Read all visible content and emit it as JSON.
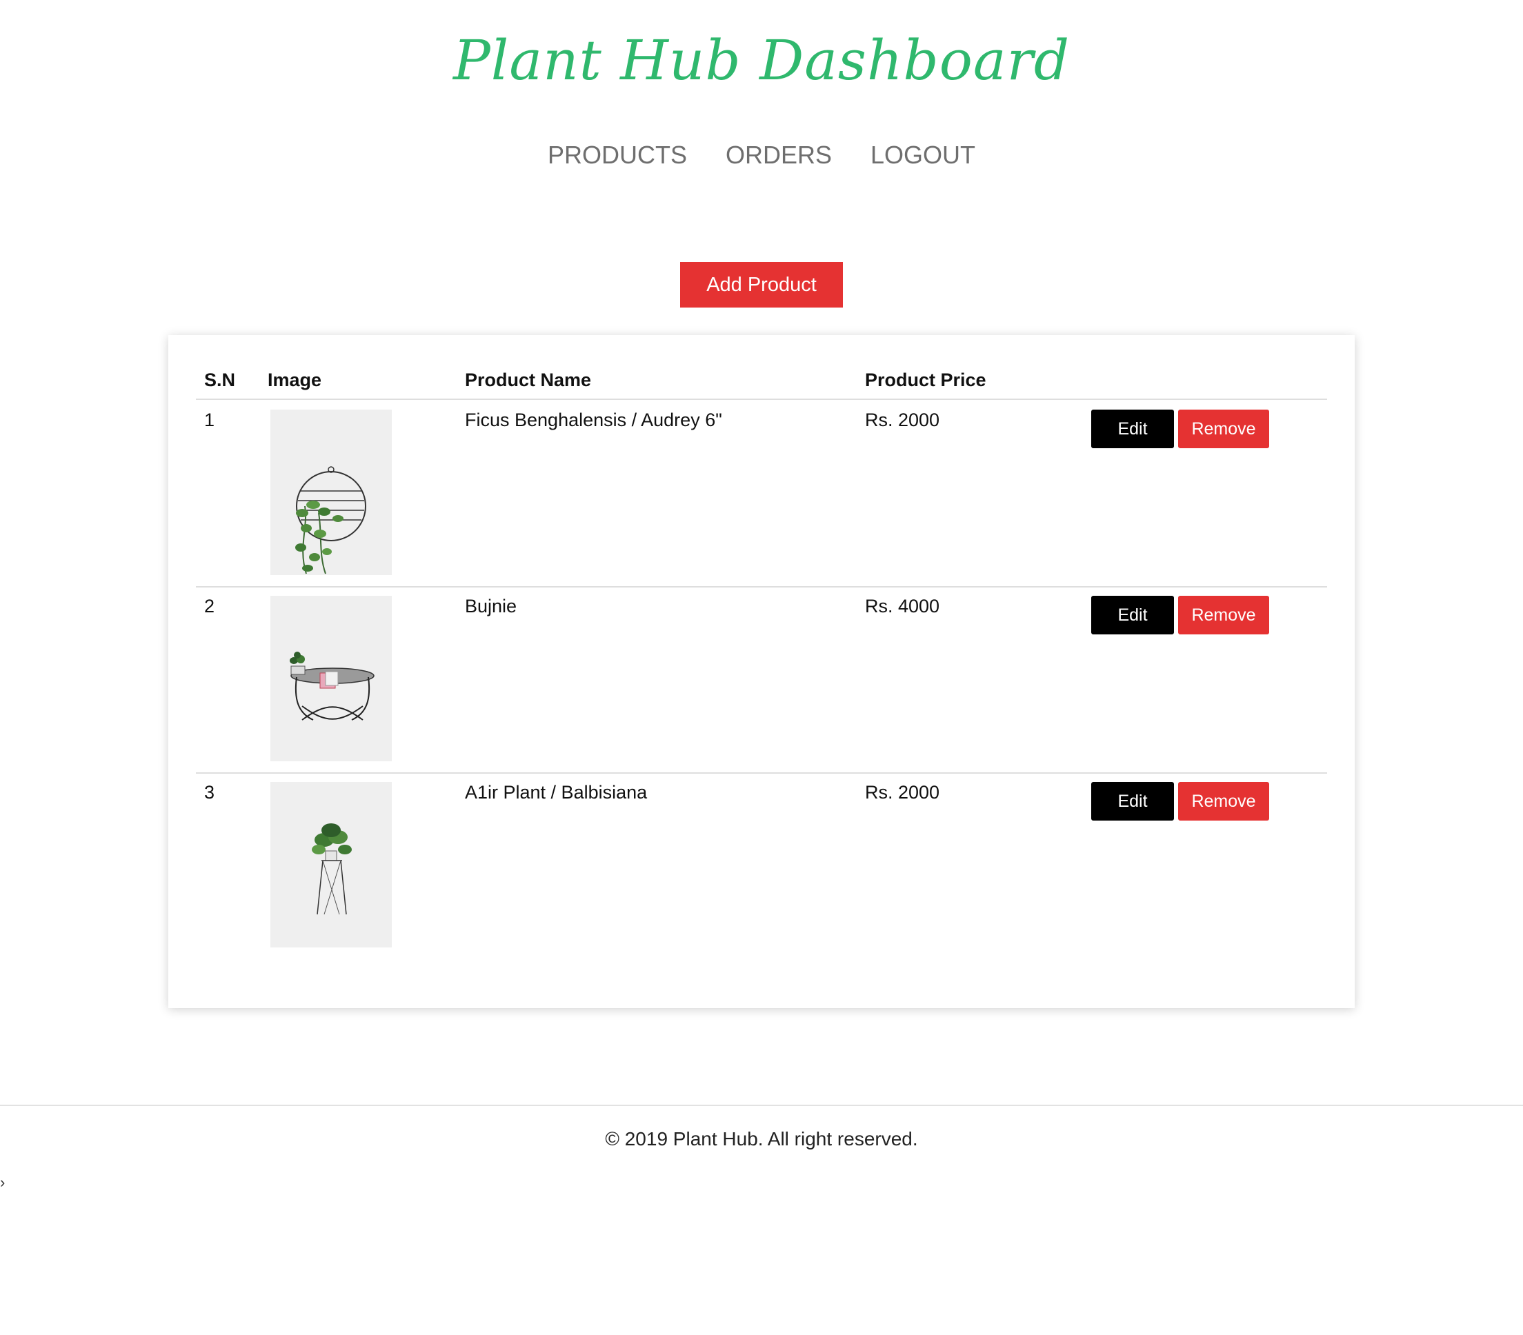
{
  "header": {
    "title": "Plant Hub Dashboard"
  },
  "nav": {
    "products": "PRODUCTS",
    "orders": "ORDERS",
    "logout": "LOGOUT"
  },
  "actions": {
    "add_product": "Add Product"
  },
  "table": {
    "headers": {
      "sn": "S.N",
      "image": "Image",
      "name": "Product Name",
      "price": "Product Price"
    },
    "rows": [
      {
        "sn": "1",
        "name": "Ficus Benghalensis / Audrey 6\"",
        "price": "Rs. 2000",
        "image_icon": "hanging-plant-ring-image",
        "edit": "Edit",
        "remove": "Remove"
      },
      {
        "sn": "2",
        "name": "Bujnie",
        "price": "Rs. 4000",
        "image_icon": "plant-on-table-image",
        "edit": "Edit",
        "remove": "Remove"
      },
      {
        "sn": "3",
        "name": "A1ir Plant / Balbisiana",
        "price": "Rs. 2000",
        "image_icon": "plant-on-stand-image",
        "edit": "Edit",
        "remove": "Remove"
      }
    ]
  },
  "footer": {
    "copyright": "© 2019 Plant Hub. All right reserved."
  },
  "misc": {
    "caret": "›"
  },
  "colors": {
    "title_green": "#2fb86d",
    "accent_red": "#e53232",
    "nav_gray": "#6e6e6e"
  }
}
